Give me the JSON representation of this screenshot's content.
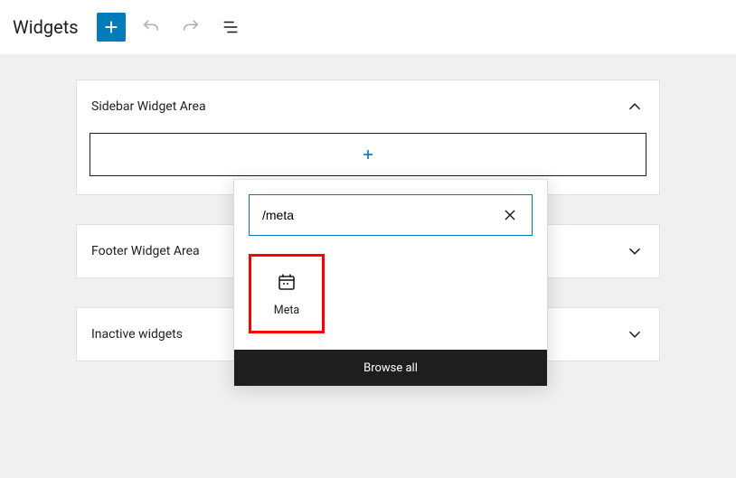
{
  "header": {
    "title": "Widgets"
  },
  "panels": [
    {
      "title": "Sidebar Widget Area",
      "expanded": true
    },
    {
      "title": "Footer Widget Area",
      "expanded": false
    },
    {
      "title": "Inactive widgets",
      "expanded": false
    }
  ],
  "inserter": {
    "search_value": "/meta",
    "results": [
      {
        "label": "Meta"
      }
    ],
    "browse_all": "Browse all"
  }
}
